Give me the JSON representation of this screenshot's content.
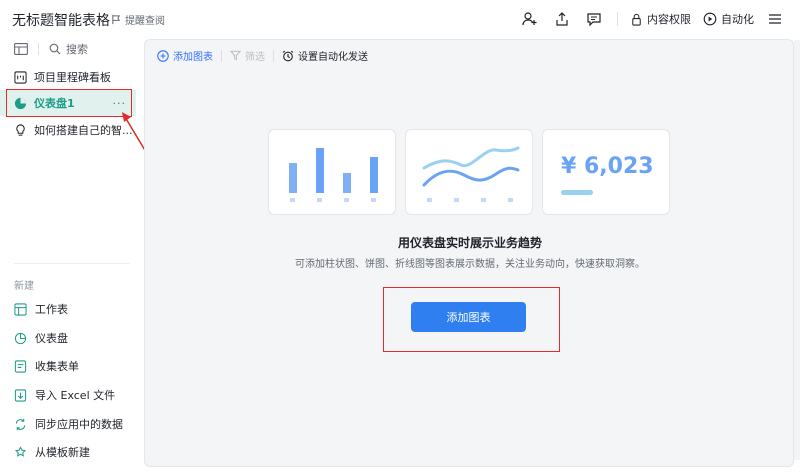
{
  "header": {
    "doc_title": "无标题智能表格",
    "sub_link": "提醒查阅",
    "permission_label": "内容权限",
    "automation_label": "自动化"
  },
  "sidebar": {
    "search_placeholder": "搜索",
    "items": [
      {
        "label": "项目里程碑看板",
        "icon": "kanban-icon"
      },
      {
        "label": "仪表盘1",
        "icon": "pie-chart-icon",
        "more": "···"
      },
      {
        "label": "如何搭建自己的智...",
        "icon": "lightbulb-icon"
      }
    ],
    "new_section_label": "新建",
    "new_items": [
      {
        "label": "工作表",
        "icon": "sheet-icon"
      },
      {
        "label": "仪表盘",
        "icon": "pie-chart-icon"
      },
      {
        "label": "收集表单",
        "icon": "form-icon"
      },
      {
        "label": "导入 Excel 文件",
        "icon": "import-icon"
      },
      {
        "label": "同步应用中的数据",
        "icon": "sync-icon"
      },
      {
        "label": "从模板新建",
        "icon": "template-icon"
      }
    ]
  },
  "toolbar": {
    "add_chart": "添加图表",
    "filter": "筛选",
    "automation_send": "设置自动化发送"
  },
  "empty_state": {
    "kpi_value": "¥ 6,023",
    "title": "用仪表盘实时展示业务趋势",
    "description": "可添加柱状图、饼图、折线图等图表展示数据，关注业务动向，快速获取洞察。",
    "button_label": "添加图表"
  },
  "colors": {
    "accent_blue": "#2f7ff0",
    "active_green": "#1c9d87",
    "highlight_red": "#e22b2b"
  }
}
